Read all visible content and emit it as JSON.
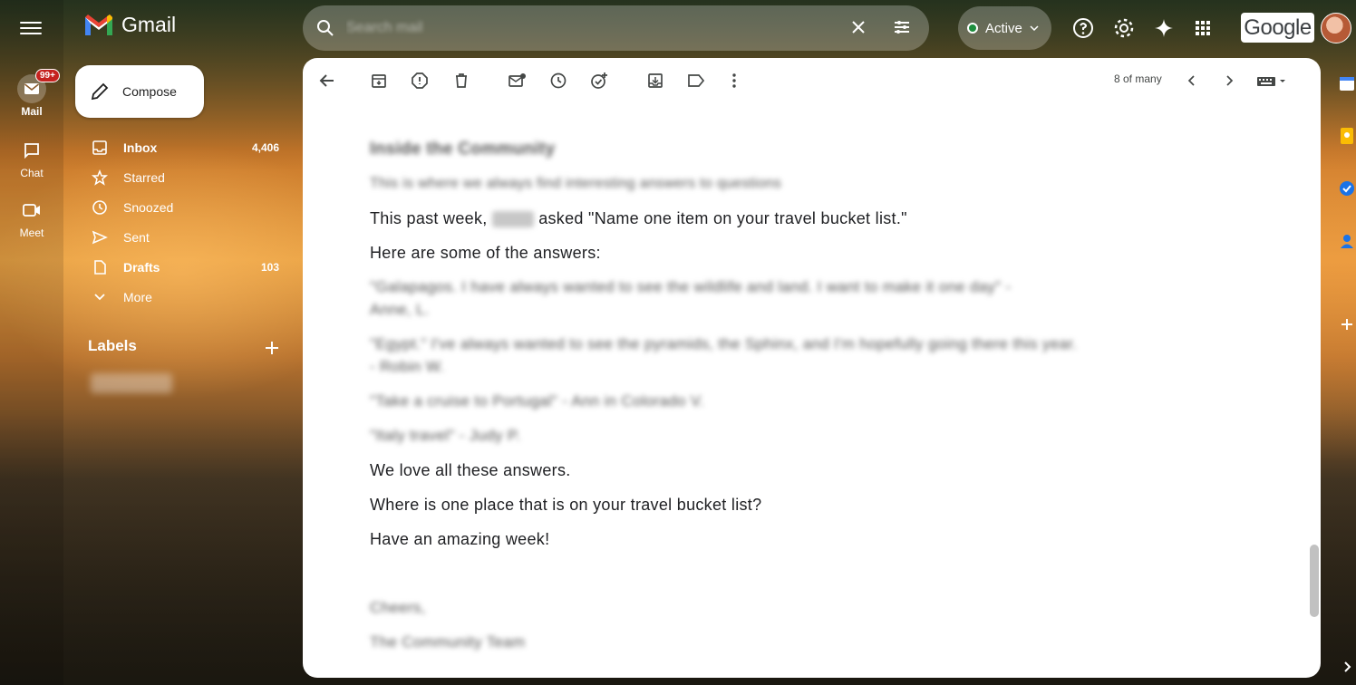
{
  "app": {
    "name": "Gmail",
    "brand_color": "#ea4335"
  },
  "rail": {
    "mail_label": "Mail",
    "mail_badge": "99+",
    "chat_label": "Chat",
    "meet_label": "Meet"
  },
  "compose": {
    "label": "Compose"
  },
  "nav": {
    "items": [
      {
        "label": "Inbox",
        "count": "4,406",
        "icon": "inbox-icon",
        "bold": true
      },
      {
        "label": "Starred",
        "count": "",
        "icon": "star-icon",
        "bold": false
      },
      {
        "label": "Snoozed",
        "count": "",
        "icon": "clock-icon",
        "bold": false
      },
      {
        "label": "Sent",
        "count": "",
        "icon": "send-icon",
        "bold": false
      },
      {
        "label": "Drafts",
        "count": "103",
        "icon": "draft-icon",
        "bold": true
      },
      {
        "label": "More",
        "count": "",
        "icon": "chevron-down-icon",
        "bold": false
      }
    ],
    "labels_heading": "Labels"
  },
  "search": {
    "placeholder": "Search mail"
  },
  "status": {
    "label": "Active",
    "color": "#1e8e3e"
  },
  "header": {
    "google_label": "Google"
  },
  "toolbar": {
    "pager": "8 of many"
  },
  "email": {
    "blurred_heading": "Inside the Community",
    "blurred_intro": "This is where we always find interesting answers to questions",
    "line1_pre": "This past week,",
    "line1_post": "asked \"Name one item on your travel bucket list.\"",
    "line2": "Here are some of the answers:",
    "blurred_a1": "\"Galapagos. I have always wanted to see the wildlife and land. I want to make it one day\" - ",
    "blurred_a1b": "Anne, L.",
    "blurred_a2": "\"Egypt.\" I've always wanted to see the pyramids, the Sphinx, and I'm hopefully going there this year.",
    "blurred_a2b": " - Robin W.",
    "blurred_a3": "\"Take a cruise to Portugal\" - Ann in Colorado V.",
    "blurred_a4": "\"Italy travel\" - Judy P.",
    "line3": "We love all these answers.",
    "line4": "Where is one place that is on your travel bucket list?",
    "line5": "Have an amazing week!",
    "blurred_sign": "Cheers,",
    "blurred_sign2": "The Community Team"
  }
}
